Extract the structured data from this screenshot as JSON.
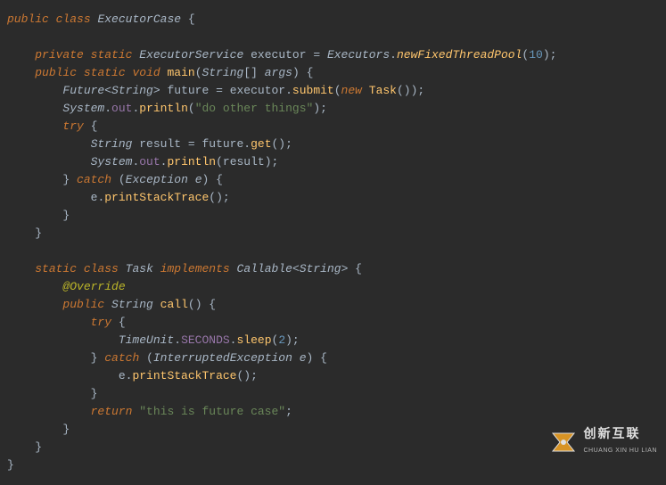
{
  "code": {
    "tokens": [
      [
        [
          "kw",
          "public"
        ],
        [
          "plain",
          " "
        ],
        [
          "kw",
          "class"
        ],
        [
          "plain",
          " "
        ],
        [
          "type-italic",
          "ExecutorCase"
        ],
        [
          "plain",
          " "
        ],
        [
          "punct",
          "{"
        ]
      ],
      [],
      [
        [
          "plain",
          "    "
        ],
        [
          "kw",
          "private"
        ],
        [
          "plain",
          " "
        ],
        [
          "kw",
          "static"
        ],
        [
          "plain",
          " "
        ],
        [
          "type-italic",
          "ExecutorService"
        ],
        [
          "plain",
          " "
        ],
        [
          "plain",
          "executor "
        ],
        [
          "punct",
          "= "
        ],
        [
          "type-italic",
          "Executors"
        ],
        [
          "punct",
          "."
        ],
        [
          "method-italic",
          "newFixedThreadPool"
        ],
        [
          "punct",
          "("
        ],
        [
          "num",
          "10"
        ],
        [
          "punct",
          ");"
        ]
      ],
      [
        [
          "plain",
          "    "
        ],
        [
          "kw",
          "public"
        ],
        [
          "plain",
          " "
        ],
        [
          "kw",
          "static"
        ],
        [
          "plain",
          " "
        ],
        [
          "kw",
          "void"
        ],
        [
          "plain",
          " "
        ],
        [
          "method-call",
          "main"
        ],
        [
          "punct",
          "("
        ],
        [
          "type-italic",
          "String"
        ],
        [
          "punct",
          "[] "
        ],
        [
          "var-italic",
          "args"
        ],
        [
          "punct",
          ") {"
        ]
      ],
      [
        [
          "plain",
          "        "
        ],
        [
          "type-italic",
          "Future"
        ],
        [
          "punct",
          "<"
        ],
        [
          "type-italic",
          "String"
        ],
        [
          "punct",
          "> "
        ],
        [
          "plain",
          "future "
        ],
        [
          "punct",
          "= "
        ],
        [
          "plain",
          "executor"
        ],
        [
          "punct",
          "."
        ],
        [
          "method-call",
          "submit"
        ],
        [
          "punct",
          "("
        ],
        [
          "kw",
          "new"
        ],
        [
          "plain",
          " "
        ],
        [
          "method-call",
          "Task"
        ],
        [
          "punct",
          "());"
        ]
      ],
      [
        [
          "plain",
          "        "
        ],
        [
          "type-italic",
          "System"
        ],
        [
          "punct",
          "."
        ],
        [
          "field",
          "out"
        ],
        [
          "punct",
          "."
        ],
        [
          "method-call",
          "println"
        ],
        [
          "punct",
          "("
        ],
        [
          "str",
          "\"do other things\""
        ],
        [
          "punct",
          ");"
        ]
      ],
      [
        [
          "plain",
          "        "
        ],
        [
          "kw",
          "try"
        ],
        [
          "plain",
          " "
        ],
        [
          "punct",
          "{"
        ]
      ],
      [
        [
          "plain",
          "            "
        ],
        [
          "type-italic",
          "String"
        ],
        [
          "plain",
          " result "
        ],
        [
          "punct",
          "= "
        ],
        [
          "plain",
          "future"
        ],
        [
          "punct",
          "."
        ],
        [
          "method-call",
          "get"
        ],
        [
          "punct",
          "();"
        ]
      ],
      [
        [
          "plain",
          "            "
        ],
        [
          "type-italic",
          "System"
        ],
        [
          "punct",
          "."
        ],
        [
          "field",
          "out"
        ],
        [
          "punct",
          "."
        ],
        [
          "method-call",
          "println"
        ],
        [
          "punct",
          "("
        ],
        [
          "plain",
          "result"
        ],
        [
          "punct",
          ");"
        ]
      ],
      [
        [
          "plain",
          "        "
        ],
        [
          "punct",
          "} "
        ],
        [
          "kw",
          "catch"
        ],
        [
          "plain",
          " "
        ],
        [
          "punct",
          "("
        ],
        [
          "type-italic",
          "Exception"
        ],
        [
          "plain",
          " "
        ],
        [
          "var-italic",
          "e"
        ],
        [
          "punct",
          ") {"
        ]
      ],
      [
        [
          "plain",
          "            "
        ],
        [
          "plain",
          "e"
        ],
        [
          "punct",
          "."
        ],
        [
          "method-call",
          "printStackTrace"
        ],
        [
          "punct",
          "();"
        ]
      ],
      [
        [
          "plain",
          "        "
        ],
        [
          "punct",
          "}"
        ]
      ],
      [
        [
          "plain",
          "    "
        ],
        [
          "punct",
          "}"
        ]
      ],
      [],
      [
        [
          "plain",
          "    "
        ],
        [
          "kw",
          "static"
        ],
        [
          "plain",
          " "
        ],
        [
          "kw",
          "class"
        ],
        [
          "plain",
          " "
        ],
        [
          "type-italic",
          "Task"
        ],
        [
          "plain",
          " "
        ],
        [
          "kw",
          "implements"
        ],
        [
          "plain",
          " "
        ],
        [
          "type-italic",
          "Callable"
        ],
        [
          "punct",
          "<"
        ],
        [
          "type-italic",
          "String"
        ],
        [
          "punct",
          "> {"
        ]
      ],
      [
        [
          "plain",
          "        "
        ],
        [
          "annotation",
          "@Override"
        ]
      ],
      [
        [
          "plain",
          "        "
        ],
        [
          "kw",
          "public"
        ],
        [
          "plain",
          " "
        ],
        [
          "type-italic",
          "String"
        ],
        [
          "plain",
          " "
        ],
        [
          "method-call",
          "call"
        ],
        [
          "punct",
          "() {"
        ]
      ],
      [
        [
          "plain",
          "            "
        ],
        [
          "kw",
          "try"
        ],
        [
          "plain",
          " "
        ],
        [
          "punct",
          "{"
        ]
      ],
      [
        [
          "plain",
          "                "
        ],
        [
          "type-italic",
          "TimeUnit"
        ],
        [
          "punct",
          "."
        ],
        [
          "field",
          "SECONDS"
        ],
        [
          "punct",
          "."
        ],
        [
          "method-call",
          "sleep"
        ],
        [
          "punct",
          "("
        ],
        [
          "num",
          "2"
        ],
        [
          "punct",
          ");"
        ]
      ],
      [
        [
          "plain",
          "            "
        ],
        [
          "punct",
          "} "
        ],
        [
          "kw",
          "catch"
        ],
        [
          "plain",
          " "
        ],
        [
          "punct",
          "("
        ],
        [
          "type-italic",
          "InterruptedException"
        ],
        [
          "plain",
          " "
        ],
        [
          "var-italic",
          "e"
        ],
        [
          "punct",
          ") {"
        ]
      ],
      [
        [
          "plain",
          "                "
        ],
        [
          "plain",
          "e"
        ],
        [
          "punct",
          "."
        ],
        [
          "method-call",
          "printStackTrace"
        ],
        [
          "punct",
          "();"
        ]
      ],
      [
        [
          "plain",
          "            "
        ],
        [
          "punct",
          "}"
        ]
      ],
      [
        [
          "plain",
          "            "
        ],
        [
          "kw",
          "return"
        ],
        [
          "plain",
          " "
        ],
        [
          "str",
          "\"this is future case\""
        ],
        [
          "punct",
          ";"
        ]
      ],
      [
        [
          "plain",
          "        "
        ],
        [
          "punct",
          "}"
        ]
      ],
      [
        [
          "plain",
          "    "
        ],
        [
          "punct",
          "}"
        ]
      ],
      [
        [
          "punct",
          "}"
        ]
      ]
    ]
  },
  "watermark": {
    "cn": "创新互联",
    "en": "CHUANG XIN HU LIAN"
  }
}
